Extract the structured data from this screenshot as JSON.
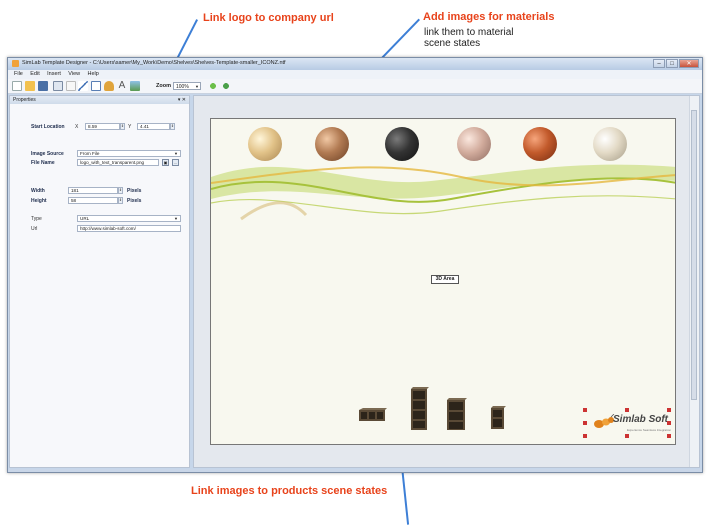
{
  "annotations": {
    "logo_link": "Link logo to company url",
    "materials_title": "Add images for materials",
    "materials_desc_1": "link them to material",
    "materials_desc_2": "scene states",
    "products_link": "Link images to products scene states"
  },
  "window": {
    "title": "SimLab Template Designer - C:\\Users\\samer\\My_Work\\Demo\\Shelves\\Shelves-Template-smaller_ICONZ.ntf",
    "buttons": {
      "minimize": "–",
      "maximize": "□",
      "close": "✕"
    }
  },
  "menu": [
    "File",
    "Edit",
    "Insert",
    "View",
    "Help"
  ],
  "toolbar": {
    "zoom_label": "Zoom",
    "zoom_value": "100%"
  },
  "properties": {
    "header": "Properties",
    "header_controls": "▾ ✕",
    "start_location_label": "Start Location",
    "x_label": "X",
    "x_value": "8.59",
    "y_label": "Y",
    "y_value": "4.41",
    "image_source_label": "Image Source",
    "image_source_value": "From File",
    "file_name_label": "File Name",
    "file_name_value": "logo_with_text_transparent.png",
    "width_label": "Width",
    "width_value": "181",
    "height_label": "Height",
    "height_value": "58",
    "pixels_label": "Pixels",
    "type_label": "Type",
    "type_value": "URL",
    "url_label": "Url",
    "url_value": "http://www.simlab-soft.com/"
  },
  "canvas": {
    "area_label": "3D Area",
    "logo_text": "Simlab Soft",
    "logo_tag": "Experience Seamless Integration",
    "material_colors": [
      "#d9b77a",
      "#a9744f",
      "#2e2e2e",
      "#cda89a",
      "#b5542a",
      "#ded4bf"
    ]
  },
  "icons": {
    "new": "new-file-icon",
    "open": "open-folder-icon",
    "save": "save-icon"
  }
}
